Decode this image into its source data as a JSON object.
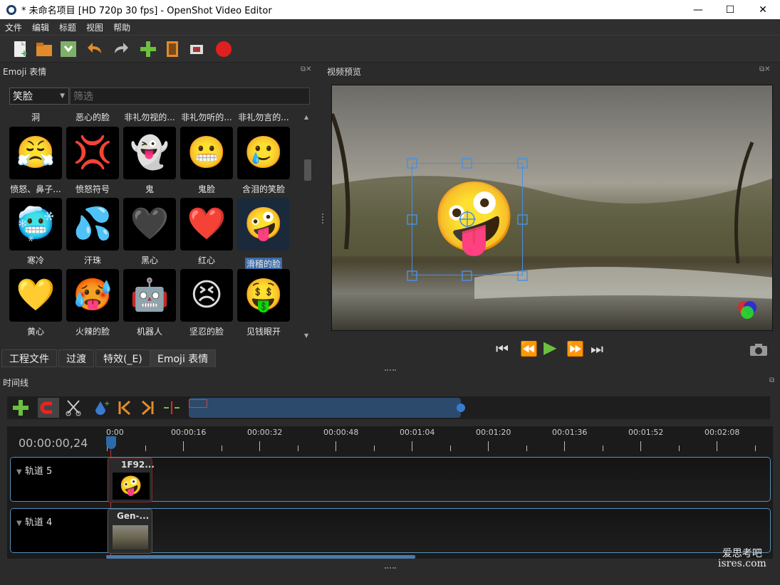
{
  "window": {
    "title": "* 未命名项目 [HD 720p 30 fps] - OpenShot Video Editor",
    "min": "—",
    "max": "☐",
    "close": "✕"
  },
  "menu": [
    "文件",
    "编辑",
    "标题",
    "视图",
    "帮助"
  ],
  "emoji_panel": {
    "title": "Emoji 表情",
    "combo": "笑脸",
    "filter_placeholder": "筛选",
    "top_labels": [
      "洞",
      "恶心的脸",
      "非礼勿视的...",
      "非礼勿听的...",
      "非礼勿言的..."
    ],
    "rows": [
      [
        {
          "glyph": "😤",
          "label": "愤怒、鼻子..."
        },
        {
          "glyph": "💢",
          "label": "愤怒符号"
        },
        {
          "glyph": "👻",
          "label": "鬼"
        },
        {
          "glyph": "😬",
          "label": "鬼脸"
        },
        {
          "glyph": "🥲",
          "label": "含泪的笑脸"
        }
      ],
      [
        {
          "glyph": "🥶",
          "label": "寒冷"
        },
        {
          "glyph": "💦",
          "label": "汗珠"
        },
        {
          "glyph": "🖤",
          "label": "黑心"
        },
        {
          "glyph": "❤️",
          "label": "红心"
        },
        {
          "glyph": "🤪",
          "label": "滑稽的脸"
        }
      ],
      [
        {
          "glyph": "💛",
          "label": "黄心"
        },
        {
          "glyph": "🥵",
          "label": "火辣的脸"
        },
        {
          "glyph": "🤖",
          "label": "机器人"
        },
        {
          "glyph": "😣",
          "label": "坚忍的脸"
        },
        {
          "glyph": "🤑",
          "label": "见钱眼开"
        }
      ]
    ]
  },
  "tabs": [
    "工程文件",
    "过渡",
    "特效(_E)",
    "Emoji 表情"
  ],
  "preview": {
    "title": "视频预览",
    "emoji": "🤪"
  },
  "timeline": {
    "title": "时间线",
    "timecode": "00:00:00,24",
    "ruler": [
      "0:00",
      "00:00:16",
      "00:00:32",
      "00:00:48",
      "00:01:04",
      "00:01:20",
      "00:01:36",
      "00:01:52",
      "00:02:08"
    ],
    "tracks": [
      {
        "name": "轨道 5",
        "clip": "1F92...",
        "clip_emoji": "🤪"
      },
      {
        "name": "轨道 4",
        "clip": "Gen-..."
      }
    ]
  },
  "watermark": {
    "line1": "爱思考吧",
    "line2": "isres.com"
  }
}
